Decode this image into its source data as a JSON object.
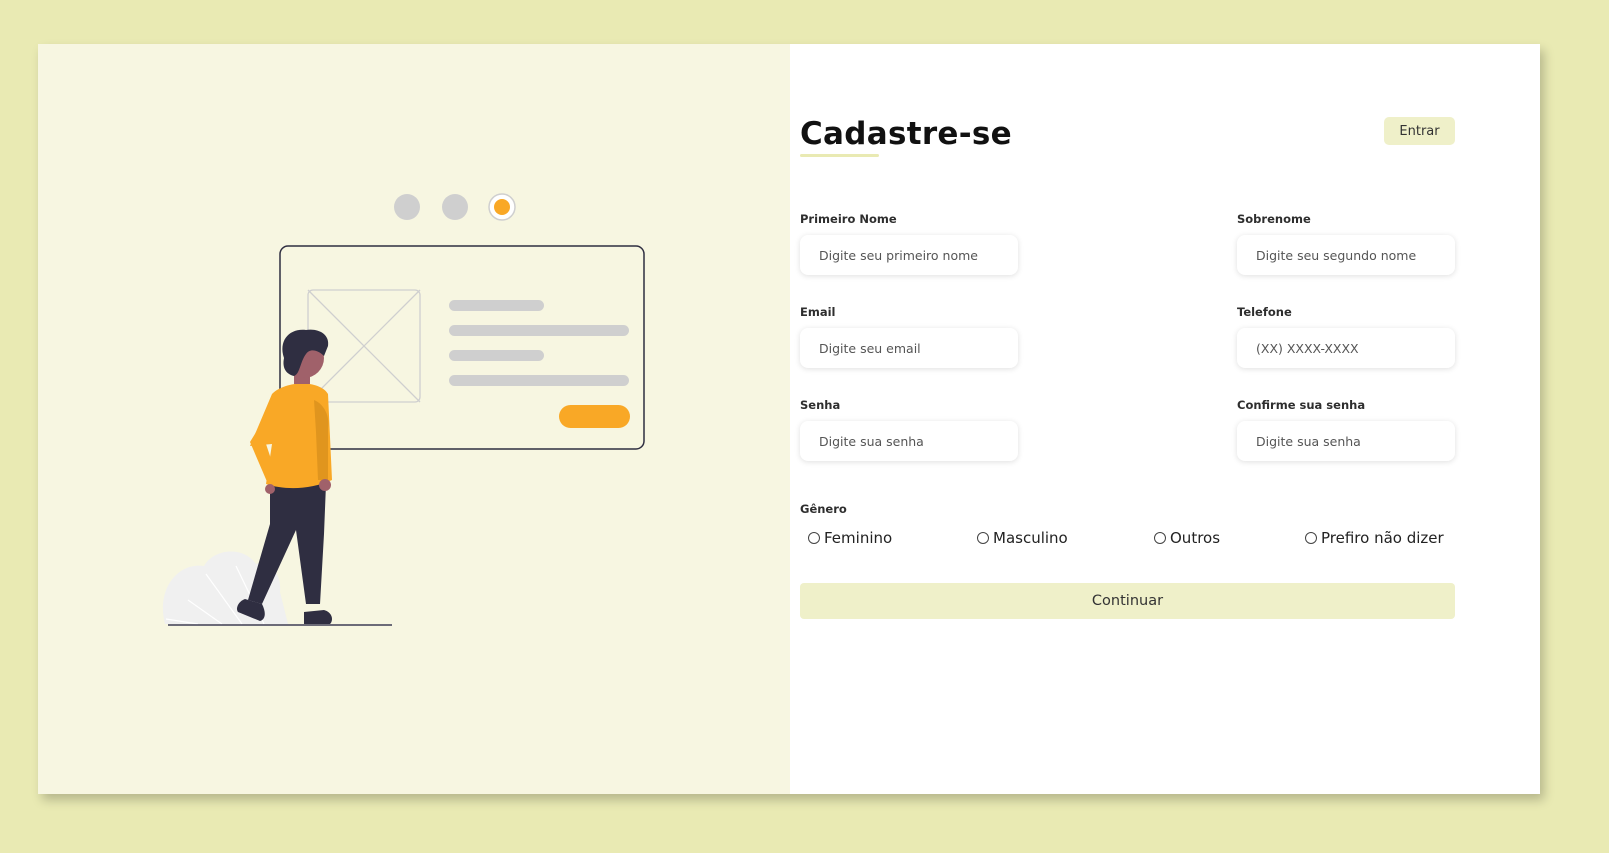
{
  "form": {
    "title": "Cadastre-se",
    "login_label": "Entrar",
    "fields": [
      {
        "label": "Primeiro Nome",
        "placeholder": "Digite seu primeiro nome"
      },
      {
        "label": "Sobrenome",
        "placeholder": "Digite seu segundo nome"
      },
      {
        "label": "Email",
        "placeholder": "Digite seu email"
      },
      {
        "label": "Telefone",
        "placeholder": "(XX) XXXX-XXXX"
      },
      {
        "label": "Senha",
        "placeholder": "Digite sua senha"
      },
      {
        "label": "Confirme sua senha",
        "placeholder": "Digite sua senha"
      }
    ],
    "gender": {
      "label": "Gênero",
      "options": [
        "Feminino",
        "Masculino",
        "Outros",
        "Prefiro não dizer"
      ]
    },
    "continue_label": "Continuar"
  },
  "colors": {
    "page_background": "#e9eab3",
    "illustration_panel": "#f7f6e1",
    "accent": "#f9a826",
    "button_background": "#eff0c9"
  },
  "illustration": {
    "icon": "person-viewing-web-page-illustration",
    "step_dots": 3,
    "active_step": 3
  }
}
